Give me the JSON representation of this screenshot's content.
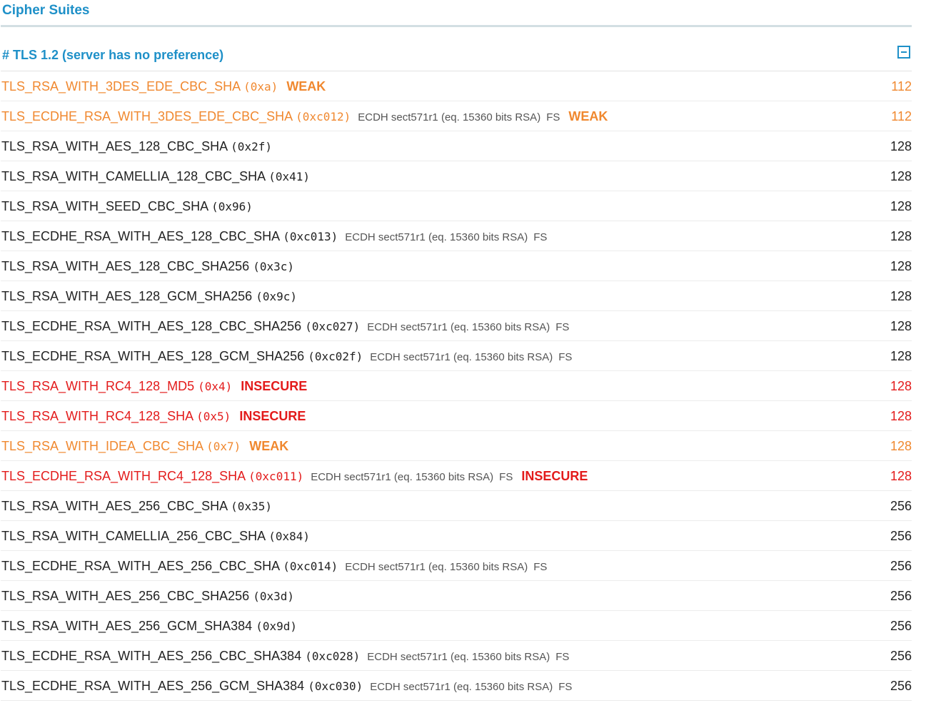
{
  "section": {
    "title": "Cipher Suites"
  },
  "table": {
    "header": "# TLS 1.2 (server has no preference)",
    "rows": [
      {
        "name": "TLS_RSA_WITH_3DES_EDE_CBC_SHA",
        "code": "(0xa)",
        "info": "",
        "fs": "",
        "tag": "WEAK",
        "bits": "112",
        "status": "weak"
      },
      {
        "name": "TLS_ECDHE_RSA_WITH_3DES_EDE_CBC_SHA",
        "code": "(0xc012)",
        "info": "ECDH sect571r1 (eq. 15360 bits RSA)",
        "fs": "FS",
        "tag": "WEAK",
        "bits": "112",
        "status": "weak"
      },
      {
        "name": "TLS_RSA_WITH_AES_128_CBC_SHA",
        "code": "(0x2f)",
        "info": "",
        "fs": "",
        "tag": "",
        "bits": "128",
        "status": "ok"
      },
      {
        "name": "TLS_RSA_WITH_CAMELLIA_128_CBC_SHA",
        "code": "(0x41)",
        "info": "",
        "fs": "",
        "tag": "",
        "bits": "128",
        "status": "ok"
      },
      {
        "name": "TLS_RSA_WITH_SEED_CBC_SHA",
        "code": "(0x96)",
        "info": "",
        "fs": "",
        "tag": "",
        "bits": "128",
        "status": "ok"
      },
      {
        "name": "TLS_ECDHE_RSA_WITH_AES_128_CBC_SHA",
        "code": "(0xc013)",
        "info": "ECDH sect571r1 (eq. 15360 bits RSA)",
        "fs": "FS",
        "tag": "",
        "bits": "128",
        "status": "ok"
      },
      {
        "name": "TLS_RSA_WITH_AES_128_CBC_SHA256",
        "code": "(0x3c)",
        "info": "",
        "fs": "",
        "tag": "",
        "bits": "128",
        "status": "ok"
      },
      {
        "name": "TLS_RSA_WITH_AES_128_GCM_SHA256",
        "code": "(0x9c)",
        "info": "",
        "fs": "",
        "tag": "",
        "bits": "128",
        "status": "ok"
      },
      {
        "name": "TLS_ECDHE_RSA_WITH_AES_128_CBC_SHA256",
        "code": "(0xc027)",
        "info": "ECDH sect571r1 (eq. 15360 bits RSA)",
        "fs": "FS",
        "tag": "",
        "bits": "128",
        "status": "ok"
      },
      {
        "name": "TLS_ECDHE_RSA_WITH_AES_128_GCM_SHA256",
        "code": "(0xc02f)",
        "info": "ECDH sect571r1 (eq. 15360 bits RSA)",
        "fs": "FS",
        "tag": "",
        "bits": "128",
        "status": "ok"
      },
      {
        "name": "TLS_RSA_WITH_RC4_128_MD5",
        "code": "(0x4)",
        "info": "",
        "fs": "",
        "tag": "INSECURE",
        "bits": "128",
        "status": "insecure"
      },
      {
        "name": "TLS_RSA_WITH_RC4_128_SHA",
        "code": "(0x5)",
        "info": "",
        "fs": "",
        "tag": "INSECURE",
        "bits": "128",
        "status": "insecure"
      },
      {
        "name": "TLS_RSA_WITH_IDEA_CBC_SHA",
        "code": "(0x7)",
        "info": "",
        "fs": "",
        "tag": "WEAK",
        "bits": "128",
        "status": "weak"
      },
      {
        "name": "TLS_ECDHE_RSA_WITH_RC4_128_SHA",
        "code": "(0xc011)",
        "info": "ECDH sect571r1 (eq. 15360 bits RSA)",
        "fs": "FS",
        "tag": "INSECURE",
        "bits": "128",
        "status": "insecure"
      },
      {
        "name": "TLS_RSA_WITH_AES_256_CBC_SHA",
        "code": "(0x35)",
        "info": "",
        "fs": "",
        "tag": "",
        "bits": "256",
        "status": "ok"
      },
      {
        "name": "TLS_RSA_WITH_CAMELLIA_256_CBC_SHA",
        "code": "(0x84)",
        "info": "",
        "fs": "",
        "tag": "",
        "bits": "256",
        "status": "ok"
      },
      {
        "name": "TLS_ECDHE_RSA_WITH_AES_256_CBC_SHA",
        "code": "(0xc014)",
        "info": "ECDH sect571r1 (eq. 15360 bits RSA)",
        "fs": "FS",
        "tag": "",
        "bits": "256",
        "status": "ok"
      },
      {
        "name": "TLS_RSA_WITH_AES_256_CBC_SHA256",
        "code": "(0x3d)",
        "info": "",
        "fs": "",
        "tag": "",
        "bits": "256",
        "status": "ok"
      },
      {
        "name": "TLS_RSA_WITH_AES_256_GCM_SHA384",
        "code": "(0x9d)",
        "info": "",
        "fs": "",
        "tag": "",
        "bits": "256",
        "status": "ok"
      },
      {
        "name": "TLS_ECDHE_RSA_WITH_AES_256_CBC_SHA384",
        "code": "(0xc028)",
        "info": "ECDH sect571r1 (eq. 15360 bits RSA)",
        "fs": "FS",
        "tag": "",
        "bits": "256",
        "status": "ok"
      },
      {
        "name": "TLS_ECDHE_RSA_WITH_AES_256_GCM_SHA384",
        "code": "(0xc030)",
        "info": "ECDH sect571r1 (eq. 15360 bits RSA)",
        "fs": "FS",
        "tag": "",
        "bits": "256",
        "status": "ok"
      }
    ]
  },
  "icons": {
    "collapse": "minus-square-icon"
  },
  "colors": {
    "accent": "#1e90c8",
    "weak": "#f0882f",
    "insecure": "#e31b1b",
    "text": "#222222",
    "muted": "#555555"
  }
}
